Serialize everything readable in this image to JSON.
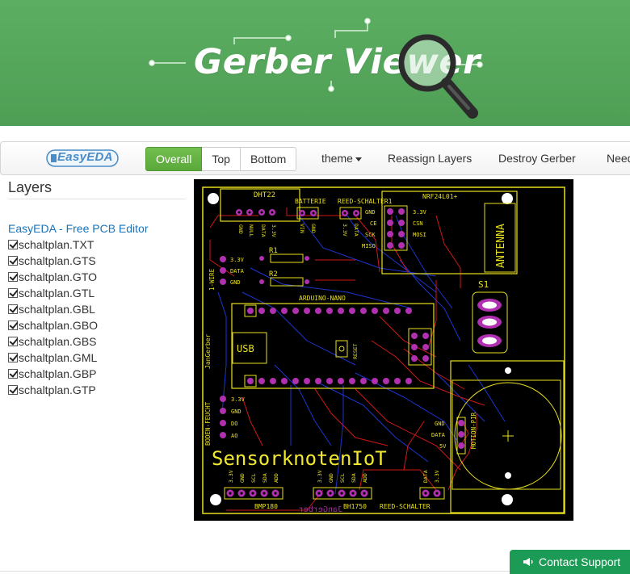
{
  "header": {
    "title": "Gerber Viewer",
    "magnifier_icon": "magnifier-icon"
  },
  "toolbar": {
    "logo_text": "EasyEDA",
    "view_buttons": [
      "Overall",
      "Top",
      "Bottom"
    ],
    "active_view": "Overall",
    "theme_label": "theme",
    "reassign_label": "Reassign Layers",
    "destroy_label": "Destroy Gerber",
    "need_label": "Need"
  },
  "layers": {
    "title": "Layers",
    "editor_link": "EasyEDA - Free PCB Editor",
    "items": [
      {
        "name": "schaltplan.TXT",
        "checked": true
      },
      {
        "name": "schaltplan.GTS",
        "checked": true
      },
      {
        "name": "schaltplan.GTO",
        "checked": true
      },
      {
        "name": "schaltplan.GTL",
        "checked": true
      },
      {
        "name": "schaltplan.GBL",
        "checked": true
      },
      {
        "name": "schaltplan.GBO",
        "checked": true
      },
      {
        "name": "schaltplan.GBS",
        "checked": true
      },
      {
        "name": "schaltplan.GML",
        "checked": true
      },
      {
        "name": "schaltplan.GBP",
        "checked": true
      },
      {
        "name": "schaltplan.GTP",
        "checked": true
      }
    ]
  },
  "pcb": {
    "board_title": "SensorknotenIoT",
    "mirrored_text": "JanGerber",
    "labels": {
      "dht22": "DHT22",
      "batterie": "BATTERIE",
      "reed1": "REED-SCHALTER1",
      "nrf": "NRF24L01+",
      "antenna": "ANTENNA",
      "s1": "S1",
      "r1": "R1",
      "r2": "R2",
      "arduino": "ARDUINO-NANO",
      "usb": "USB",
      "reset": "RESET",
      "onewire": "1-WIRE",
      "jangerber": "JanGerber",
      "boden": "BODEN-FEUCHT",
      "motion": "MOTION-PIR",
      "bmp": "BMP180",
      "bh": "BH1750",
      "reed2": "REED-SCHALTER",
      "gnd": "GND",
      "null": "NULL",
      "data": "DATA",
      "v33": "3.3V",
      "vin": "VIN",
      "ce": "CE",
      "sck": "SCK",
      "miso": "MISO",
      "csn": "CSN",
      "mosi": "MOSI",
      "do": "DO",
      "ao": "AO",
      "scl": "SCL",
      "sda": "SDA",
      "add": "ADD",
      "v5": "5V"
    }
  },
  "support": {
    "label": "Contact Support"
  },
  "colors": {
    "brand_green": "#55a95b",
    "silk": "#f0e830",
    "pad": "#a020a0",
    "trace_top": "#d01818",
    "trace_bottom": "#1830c8"
  }
}
